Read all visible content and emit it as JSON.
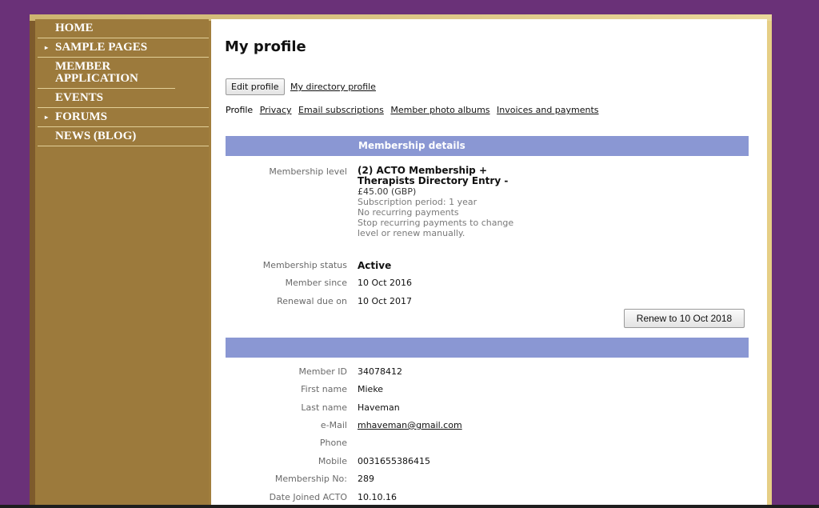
{
  "nav": {
    "items": [
      {
        "label": "HOME",
        "arrow": ""
      },
      {
        "label": "SAMPLE PAGES",
        "arrow": "▸"
      },
      {
        "label": "MEMBER APPLICATION",
        "arrow": ""
      },
      {
        "label": "EVENTS",
        "arrow": ""
      },
      {
        "label": "FORUMS",
        "arrow": "▸"
      },
      {
        "label": "NEWS (BLOG)",
        "arrow": ""
      }
    ]
  },
  "page": {
    "title": "My profile",
    "edit_button": "Edit profile",
    "directory_link": "My directory profile"
  },
  "subnav": {
    "profile": "Profile",
    "privacy": "Privacy",
    "email_subscriptions": "Email subscriptions",
    "photo_albums": "Member photo albums",
    "invoices": "Invoices and payments"
  },
  "membership": {
    "section_title": "Membership details",
    "level_label": "Membership level",
    "level_name": "(2) ACTO Membership + Therapists Directory Entry -",
    "price": "£45.00 (GBP)",
    "period": "Subscription period: 1 year",
    "recurring": "No recurring payments",
    "note": "Stop recurring payments to change level or renew manually.",
    "status_label": "Membership status",
    "status_value": "Active",
    "since_label": "Member since",
    "since_value": "10 Oct 2016",
    "renewal_label": "Renewal due on",
    "renewal_value": "10 Oct 2017",
    "renew_button": "Renew to 10 Oct 2018"
  },
  "details": {
    "section_title": "",
    "member_id_label": "Member ID",
    "member_id": "34078412",
    "first_name_label": "First name",
    "first_name": "Mieke",
    "last_name_label": "Last name",
    "last_name": "Haveman",
    "email_label": "e-Mail",
    "email": "mhaveman@gmail.com",
    "phone_label": "Phone",
    "phone": "",
    "mobile_label": "Mobile",
    "mobile": "0031655386415",
    "membership_no_label": "Membership No:",
    "membership_no": "289",
    "date_joined_label": "Date Joined ACTO",
    "date_joined": "10.10.16"
  },
  "colors": {
    "background": "#6a3178",
    "sidebar": "#9c7a3c",
    "section_bar": "#8a97d3"
  }
}
